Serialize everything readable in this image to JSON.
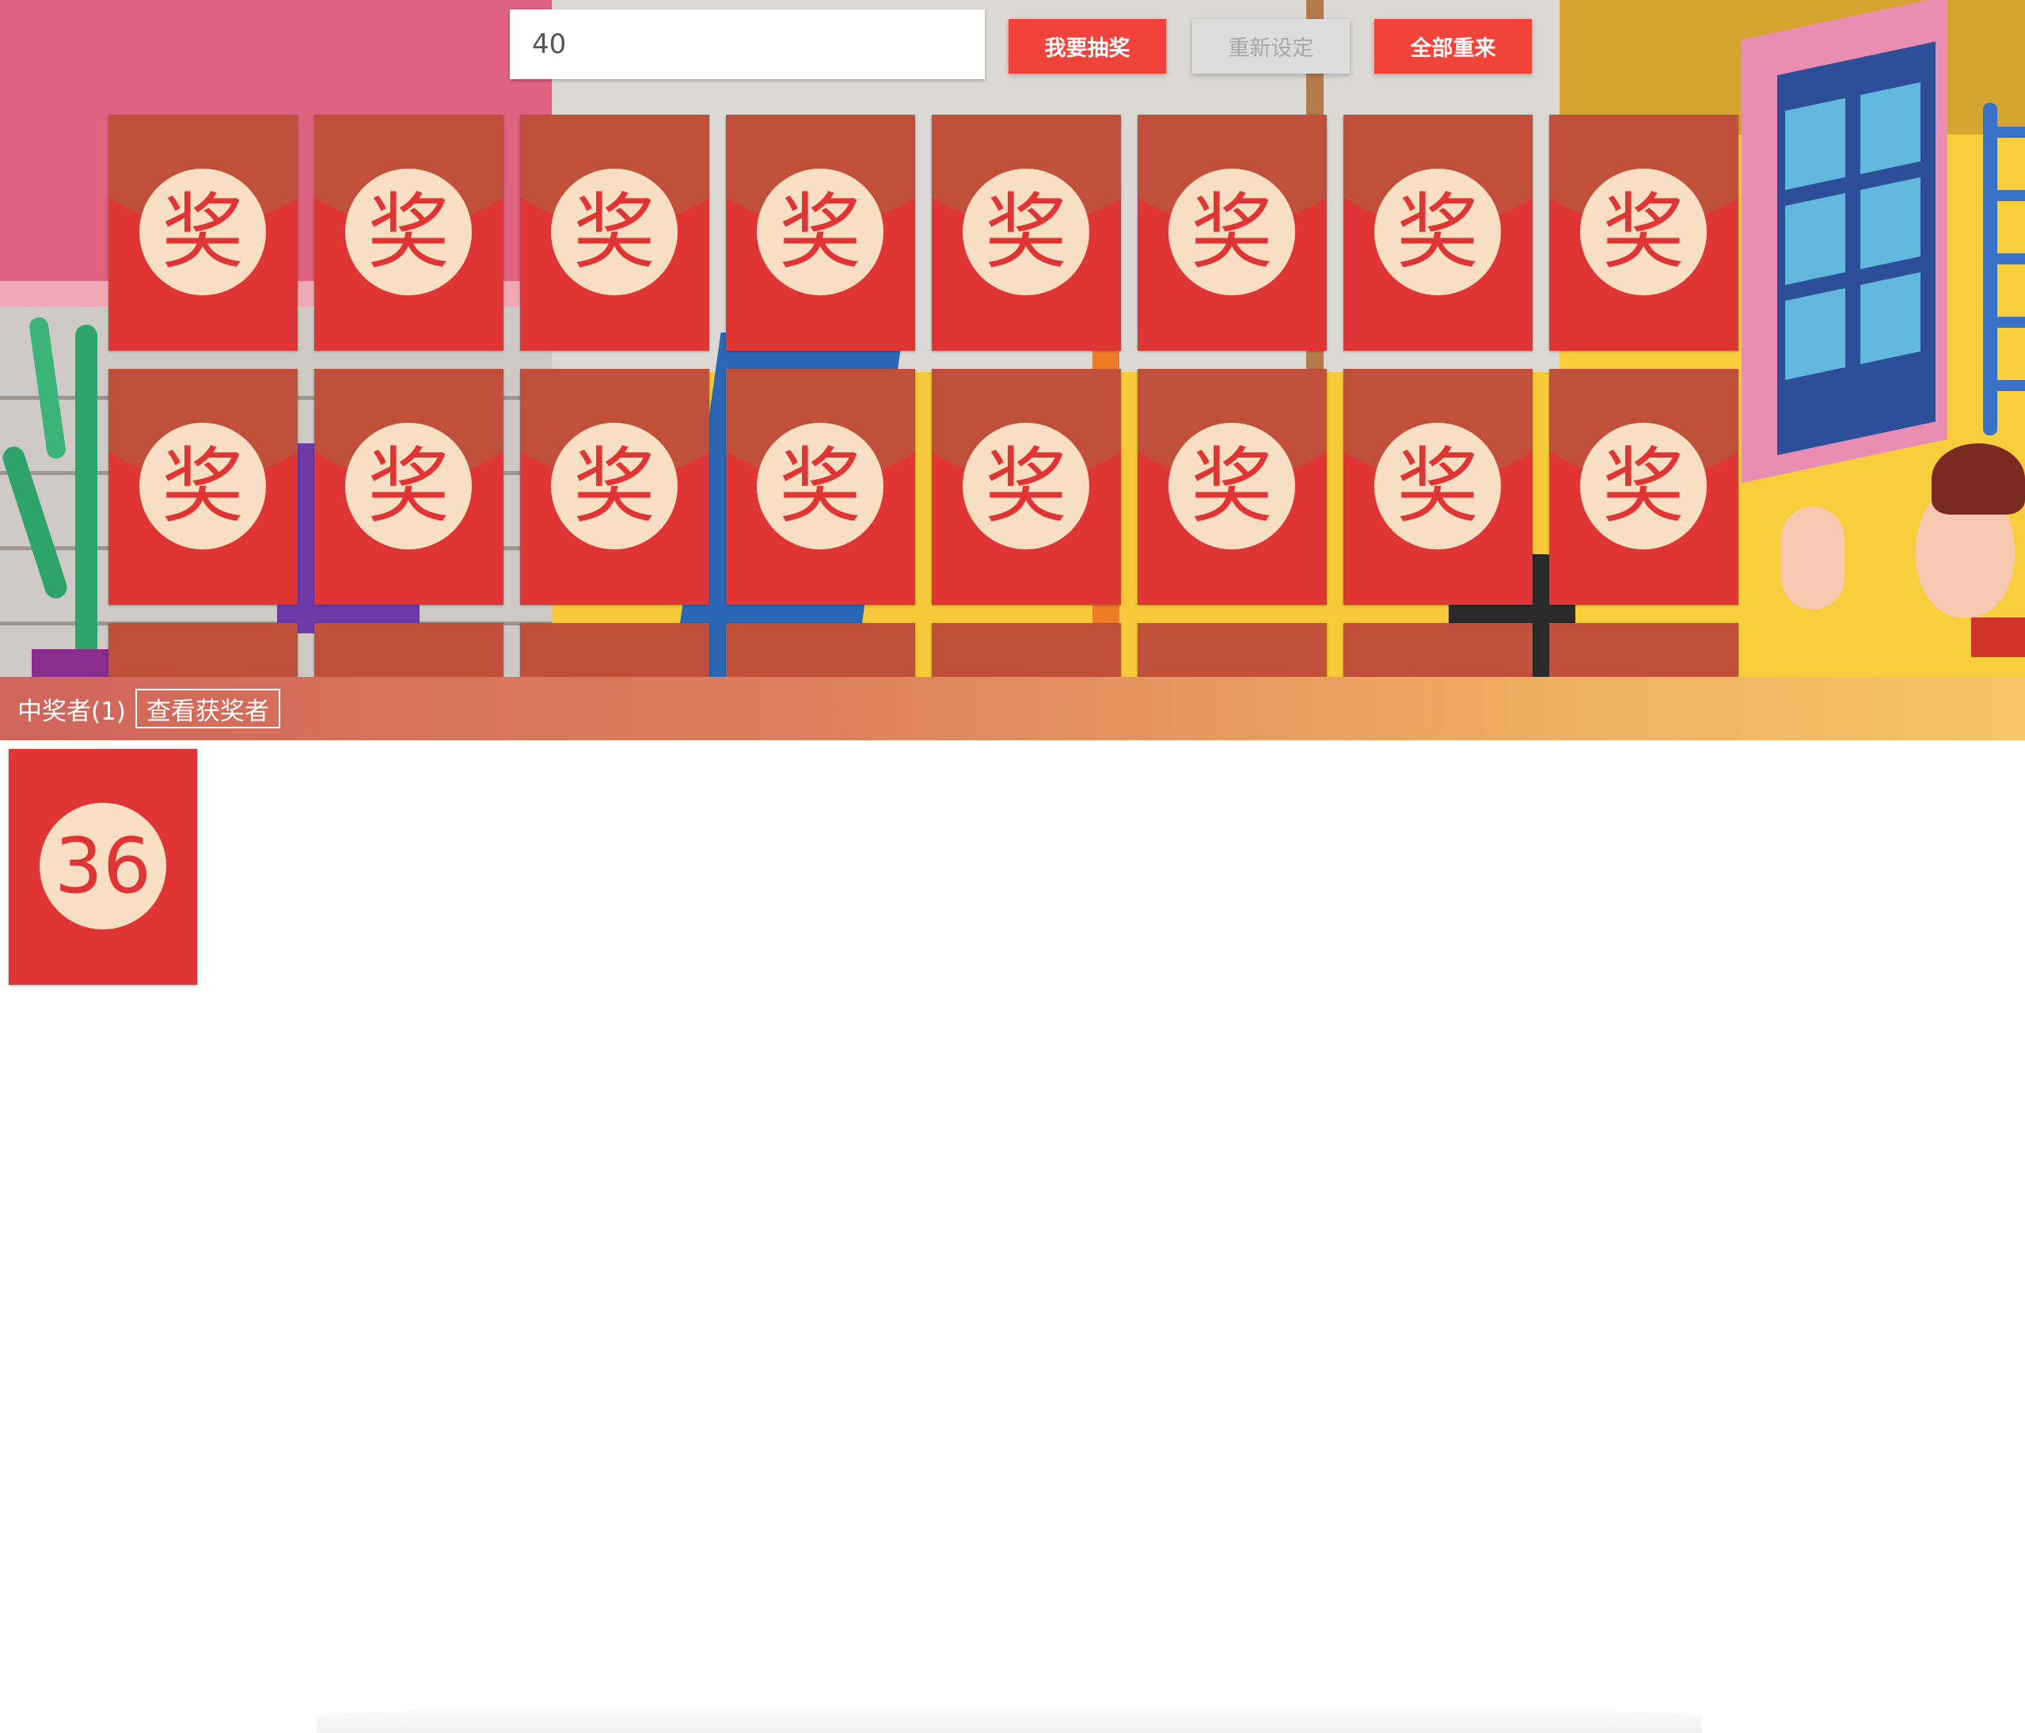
{
  "controls": {
    "number_input_value": "40",
    "draw_button": "我要抽奖",
    "reset_button": "重新设定",
    "restart_button": "全部重来"
  },
  "envelope": {
    "label": "奖"
  },
  "grid": {
    "columns": 8,
    "full_rows": 2,
    "partial_row_visible": true
  },
  "winners": {
    "count_label": "中奖者(1)",
    "view_button": "查看获奖者",
    "items": [
      {
        "number": "36"
      }
    ]
  },
  "colors": {
    "envelope_body": "#e03535",
    "envelope_flap": "#c0503a",
    "seal": "#f8dfc4",
    "primary_button": "#f0433a",
    "disabled_button": "#dddcdc"
  }
}
